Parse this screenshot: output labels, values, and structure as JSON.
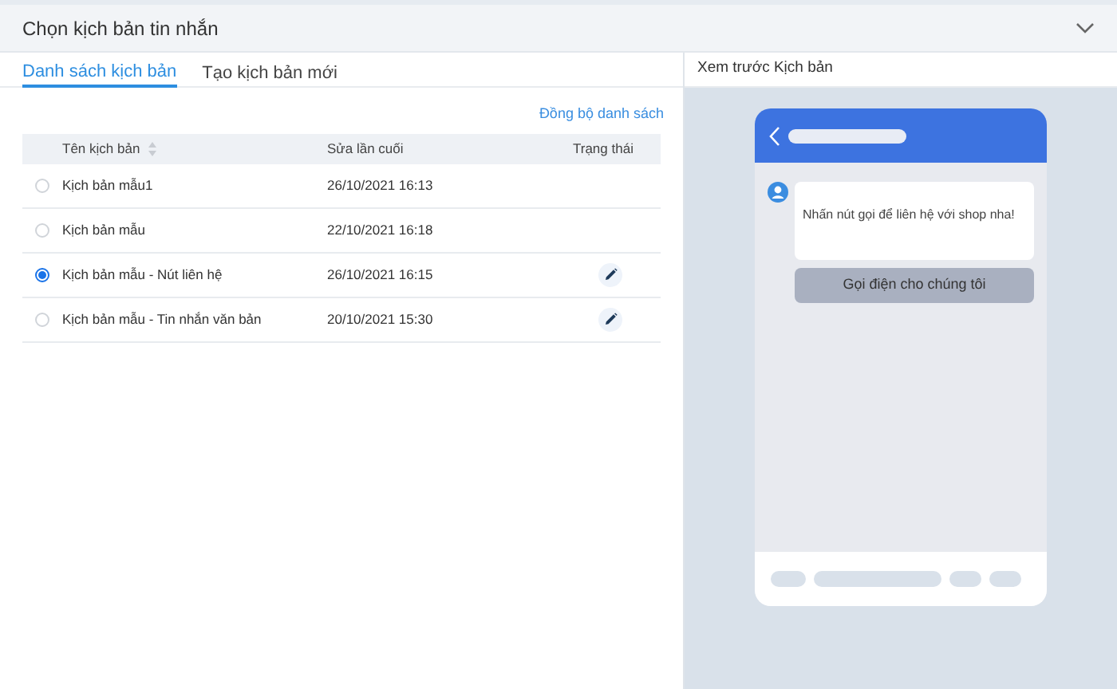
{
  "header": {
    "title": "Chọn kịch bản tin nhắn"
  },
  "tabs": [
    {
      "label": "Danh sách kịch bản",
      "selected": true
    },
    {
      "label": "Tạo kịch bản mới",
      "selected": false
    }
  ],
  "sync_link": "Đồng bộ danh sách",
  "table": {
    "columns": [
      "Tên kịch bản",
      "Sửa lần cuối",
      "Trạng thái"
    ],
    "rows": [
      {
        "name": "Kịch bản mẫu1",
        "modified": "26/10/2021 16:13",
        "selected": false,
        "editable": false
      },
      {
        "name": "Kịch bản mẫu",
        "modified": "22/10/2021 16:18",
        "selected": false,
        "editable": false
      },
      {
        "name": "Kịch bản mẫu - Nút liên hệ",
        "modified": "26/10/2021 16:15",
        "selected": true,
        "editable": true
      },
      {
        "name": "Kịch bản mẫu - Tin nhắn văn bản",
        "modified": "20/10/2021 15:30",
        "selected": false,
        "editable": true
      }
    ]
  },
  "preview": {
    "title": "Xem trước Kịch bản",
    "message": "Nhấn nút gọi để liên hệ với shop nha!",
    "button": "Gọi điện cho chúng tôi"
  }
}
